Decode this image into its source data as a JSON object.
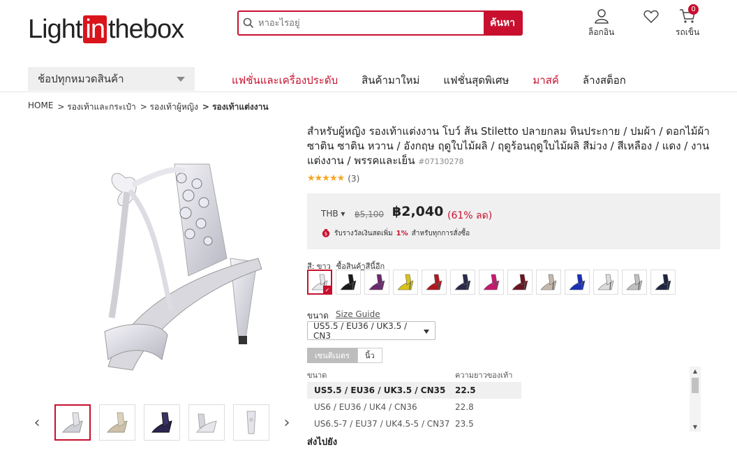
{
  "header": {
    "logo": {
      "part1": "Light",
      "part2": "in",
      "part3": "thebox"
    },
    "search_placeholder": "หาอะไรอยู่",
    "search_button": "ค้นหา",
    "login_label": "ล็อกอิน",
    "cart_label": "รถเข็น",
    "cart_count": "0"
  },
  "nav": {
    "category_button": "ช้อปทุกหมวดสินค้า",
    "items": [
      {
        "label": "แฟชั่นและเครื่องประดับ",
        "color": "#c8102e"
      },
      {
        "label": "สินค้ามาใหม่",
        "color": "#222222"
      },
      {
        "label": "แฟชั่นสุดพิเศษ",
        "color": "#222222"
      },
      {
        "label": "มาสค์",
        "color": "#c8102e"
      },
      {
        "label": "ล้างสต็อก",
        "color": "#222222"
      }
    ]
  },
  "breadcrumb": [
    "HOME",
    "> รองเท้าและกระเป๋า",
    "> รองเท้าผู้หญิง",
    "> รองเท้าแต่งงาน"
  ],
  "product": {
    "title": "สำหรับผู้หญิง รองเท้าแต่งงาน โบว์ ส้น Stiletto ปลายกลม หินประกาย / ปมผ้า / ดอกไม้ผ้าซาติน ซาติน หวาน / อังกฤษ ฤดูใบไม้ผลิ / ฤดูร้อนฤดูใบไม้ผลิ สีม่วง / สีเหลือง / แดง / งานแต่งงาน / พรรคและเย็น",
    "code": "#07130278",
    "stars": "★★★★★",
    "reviews": "(3)",
    "currency": "THB ▾",
    "old_price": "฿5,100",
    "new_price": "฿2,040",
    "discount": "(61% ลด)",
    "reward_pre": "รับรางวัลเงินสดเพิ่ม",
    "reward_pct": "1%",
    "reward_post": "สำหรับทุกการสั่งซื้อ",
    "color_label": "สี: ขาว",
    "color_link": "ซื้อสินค้าสีนี้อีก",
    "swatch_colors": [
      "#e8e8ee",
      "#1a1a1a",
      "#6b2a6e",
      "#d8c21a",
      "#b0181f",
      "#2a2a4a",
      "#c8176f",
      "#6a1522",
      "#c4b8ac",
      "#1a2fb8",
      "#dcdcdc",
      "#c0c0c0",
      "#1f2540"
    ],
    "size_label": "ขนาด",
    "size_guide": "Size Guide",
    "size_selected": "US5.5 / EU36 / UK3.5 / CN3",
    "unit_tabs": [
      "เซนติเมตร",
      "นิ้ว"
    ],
    "size_table": {
      "headers": [
        "ขนาด",
        "ความยาวของเท้า"
      ],
      "rows": [
        [
          "US5.5 / EU36 / UK3.5 / CN35",
          "22.5"
        ],
        [
          "US6 / EU36 / UK4 / CN36",
          "22.8"
        ],
        [
          "US6.5-7 / EU37 / UK4.5-5 / CN37",
          "23.5"
        ]
      ]
    },
    "shipping_label": "ส่งไปยัง"
  }
}
